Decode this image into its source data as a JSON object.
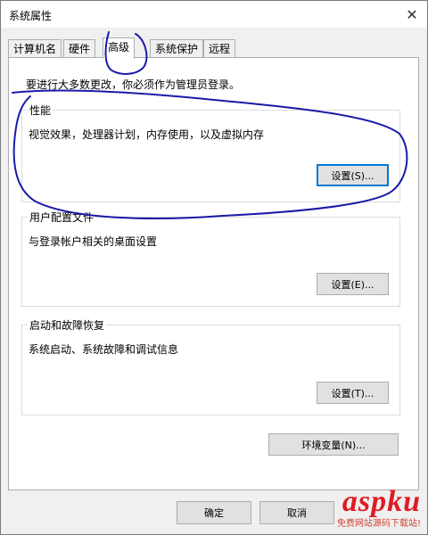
{
  "window": {
    "title": "系统属性"
  },
  "tabs": [
    {
      "label": "计算机名"
    },
    {
      "label": "硬件"
    },
    {
      "label": "高级"
    },
    {
      "label": "系统保护"
    },
    {
      "label": "远程"
    }
  ],
  "notice": "要进行大多数更改，你必须作为管理员登录。",
  "performance": {
    "title": "性能",
    "desc": "视觉效果，处理器计划，内存使用，以及虚拟内存",
    "button": "设置(S)..."
  },
  "user_profiles": {
    "title": "用户配置文件",
    "desc": "与登录帐户相关的桌面设置",
    "button": "设置(E)..."
  },
  "startup": {
    "title": "启动和故障恢复",
    "desc": "系统启动、系统故障和调试信息",
    "button": "设置(T)..."
  },
  "env_button": "环境变量(N)...",
  "footer": {
    "ok": "确定",
    "cancel": "取消"
  },
  "watermark": {
    "logo": "aspku",
    "subtitle": "免费网站源码下载站!"
  },
  "colors": {
    "annotation": "#1a1aa8",
    "focus_border": "#0078d7",
    "watermark": "#e01b24"
  }
}
